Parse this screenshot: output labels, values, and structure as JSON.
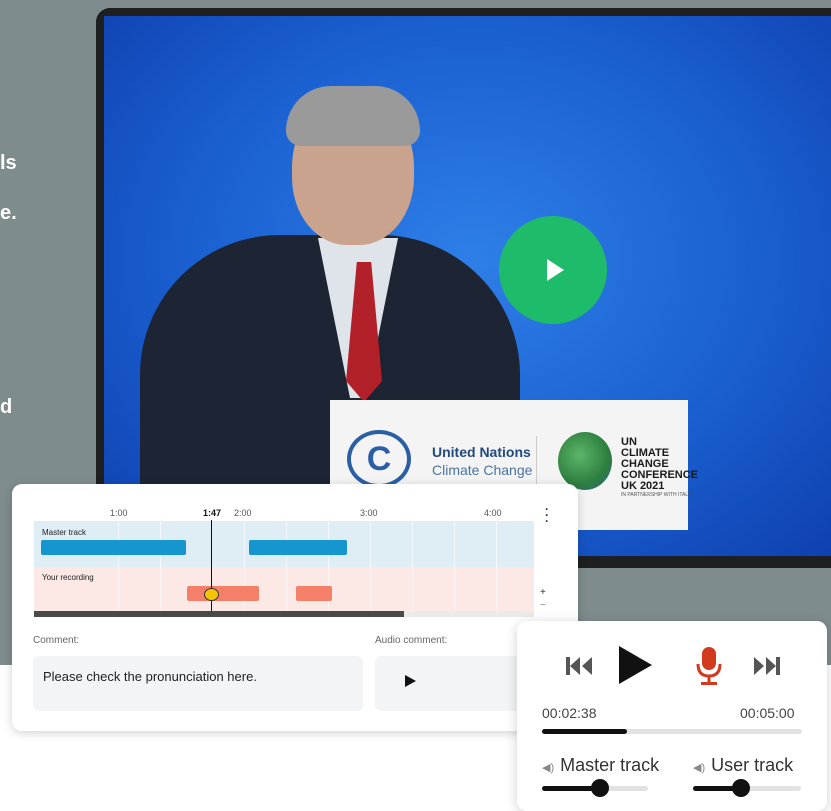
{
  "left_text": {
    "line1": "ls",
    "line2": "e.",
    "line3": "d"
  },
  "video": {
    "logo_text": "C",
    "org_title": "United Nations",
    "org_subtitle": "Climate Change",
    "conference": "UN CLIMATE CHANGE CONFERENCE UK 2021",
    "partnership": "IN PARTNERSHIP WITH ITALY"
  },
  "editor": {
    "timeline_ticks": [
      "1:00",
      "1:47",
      "2:00",
      "3:00",
      "4:00"
    ],
    "current_time": "1:47",
    "master_label": "Master track",
    "user_label": "Your recording",
    "zoom_in": "+",
    "zoom_out": "−",
    "menu_icon": "vertical-dots-icon",
    "comment_label": "Comment:",
    "comment_text": "Please check the pronunciation here.",
    "audio_comment_label": "Audio comment:",
    "scroll_progress": 0.74
  },
  "player": {
    "current_time": "00:02:38",
    "total_time": "00:05:00",
    "progress": 0.33,
    "master_label": "Master track",
    "user_label": "User track",
    "master_volume": 0.55,
    "user_volume": 0.45,
    "colors": {
      "mic": "#d23a1e",
      "play": "#1ebc6a",
      "panel": "#ffffff"
    }
  }
}
